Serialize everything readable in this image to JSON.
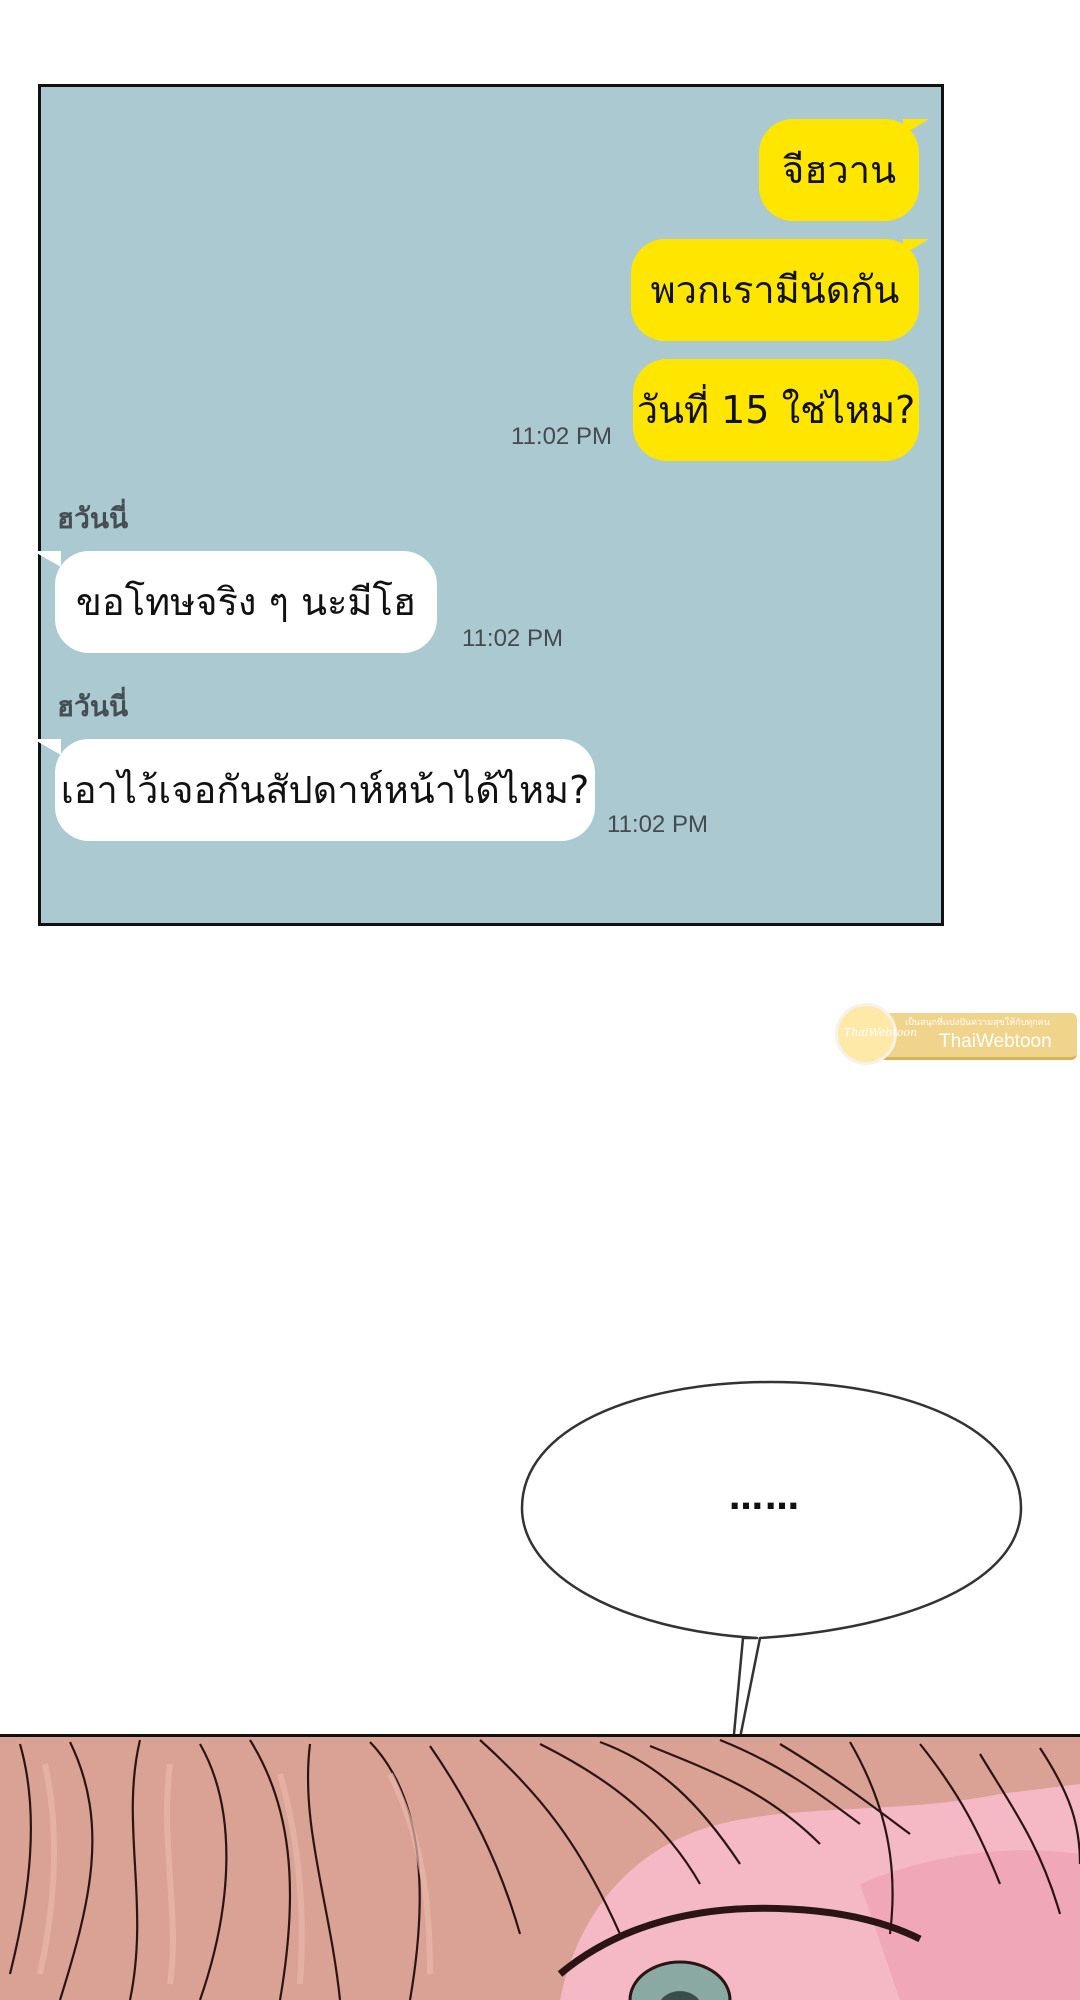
{
  "chat": {
    "outgoing": [
      {
        "text": "จีฮวาน"
      },
      {
        "text": "พวกเรามีนัดกัน"
      },
      {
        "text": "วันที่ 15 ใช่ไหม?"
      }
    ],
    "outgoing_time": "11:02 PM",
    "incoming": [
      {
        "sender": "ฮวันนี่",
        "text": "ขอโทษจริง ๆ นะมีโฮ",
        "time": "11:02 PM"
      },
      {
        "sender": "ฮวันนี่",
        "text": "เอาไว้เจอกันสัปดาห์หน้าได้ไหม?",
        "time": "11:02 PM"
      }
    ],
    "colors": {
      "panel_background": "#abc9d1",
      "outgoing_bubble": "#ffe600",
      "incoming_bubble": "#ffffff"
    }
  },
  "watermark": {
    "tagline": "เป็นสนุกที่เเบ่งปันความสุขให้กับทุกคน",
    "title": "ThaiWebtoon",
    "logo_text": "ThaiWebtoon",
    "color": "#f1d48c"
  },
  "speech_bubble": {
    "text": "……"
  },
  "illustration": {
    "subject": "close-up-of-eye-under-hair",
    "colors": {
      "hair": "#d9a295",
      "skin": "#f4b9c5",
      "iris": "#8aa9a3",
      "outline": "#2a1414"
    }
  }
}
